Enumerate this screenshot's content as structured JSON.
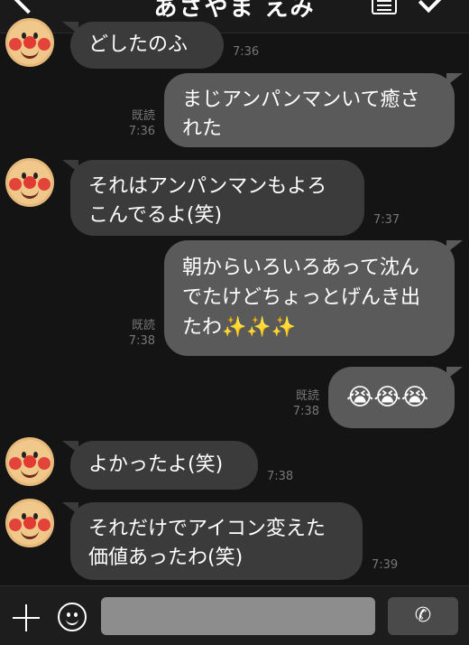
{
  "header": {
    "title": "あさやま えみ"
  },
  "messages": [
    {
      "text": "どしたのふ",
      "time": "7:36"
    },
    {
      "text": "まじアンパンマンいて癒された",
      "read": "既読",
      "time": "7:36"
    },
    {
      "text": "それはアンパンマンもよろこんでるよ(笑)",
      "time": "7:37"
    },
    {
      "text": "朝からいろいろあって沈んでたけどちょっとげんき出たわ✨✨✨",
      "read": "既読",
      "time": "7:38"
    },
    {
      "text": "😭😭😭",
      "read": "既読",
      "time": "7:38"
    },
    {
      "text": "よかったよ(笑)",
      "time": "7:38"
    },
    {
      "text": "それだけでアイコン変えた価値あったわ(笑)",
      "time": "7:39"
    }
  ],
  "composer": {
    "placeholder": ""
  },
  "icons": [
    "back-icon",
    "notes-icon",
    "check-icon",
    "avatar",
    "plus-icon",
    "smile-icon",
    "phone-icon"
  ]
}
